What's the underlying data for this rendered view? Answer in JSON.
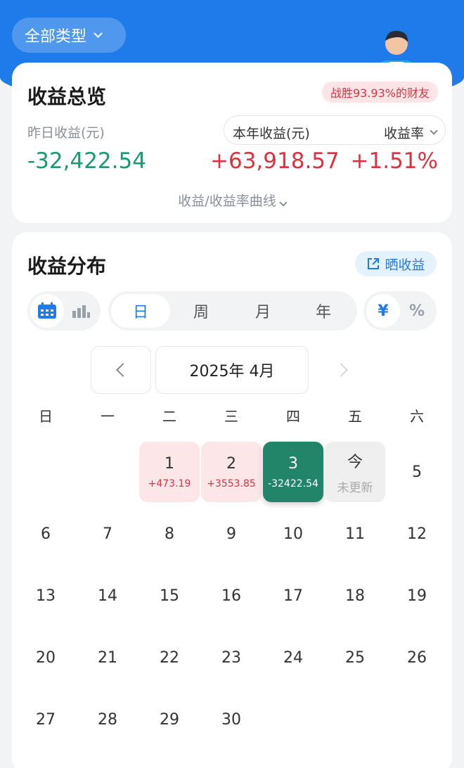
{
  "header": {
    "filter_label": "全部类型"
  },
  "overview": {
    "title": "收益总览",
    "beat_badge": "战胜93.93%的财友",
    "yesterday_label": "昨日收益(元)",
    "yesterday_value": "-32,422.54",
    "year_label": "本年收益(元)",
    "year_value": "+63,918.57",
    "rate_label": "收益率",
    "rate_value": "+1.51%",
    "curve_link": "收益/收益率曲线"
  },
  "distribution": {
    "title": "收益分布",
    "share_button": "晒收益",
    "period_tabs": [
      "日",
      "周",
      "月",
      "年"
    ],
    "active_period": "日",
    "unit_options": [
      "¥",
      "%"
    ],
    "active_unit": "¥",
    "month_label": "2025年 4月",
    "weekdays": [
      "日",
      "一",
      "二",
      "三",
      "四",
      "五",
      "六"
    ],
    "days": [
      {
        "d": "1",
        "sub": "+473.19",
        "state": "pos"
      },
      {
        "d": "2",
        "sub": "+3553.85",
        "state": "pos"
      },
      {
        "d": "3",
        "sub": "-32422.54",
        "state": "sel"
      },
      {
        "d": "今",
        "sub": "未更新",
        "state": "today"
      },
      {
        "d": "5"
      },
      {
        "d": "6"
      },
      {
        "d": "7"
      },
      {
        "d": "8"
      },
      {
        "d": "9"
      },
      {
        "d": "10"
      },
      {
        "d": "11"
      },
      {
        "d": "12"
      },
      {
        "d": "13"
      },
      {
        "d": "14"
      },
      {
        "d": "15"
      },
      {
        "d": "16"
      },
      {
        "d": "17"
      },
      {
        "d": "18"
      },
      {
        "d": "19"
      },
      {
        "d": "20"
      },
      {
        "d": "21"
      },
      {
        "d": "22"
      },
      {
        "d": "23"
      },
      {
        "d": "24"
      },
      {
        "d": "25"
      },
      {
        "d": "26"
      },
      {
        "d": "27"
      },
      {
        "d": "28"
      },
      {
        "d": "29"
      },
      {
        "d": "30"
      }
    ],
    "first_weekday_index": 2
  },
  "colors": {
    "brand": "#1f7bea",
    "gain": "#d8333f",
    "loss": "#189a73",
    "selected": "#22856a"
  }
}
